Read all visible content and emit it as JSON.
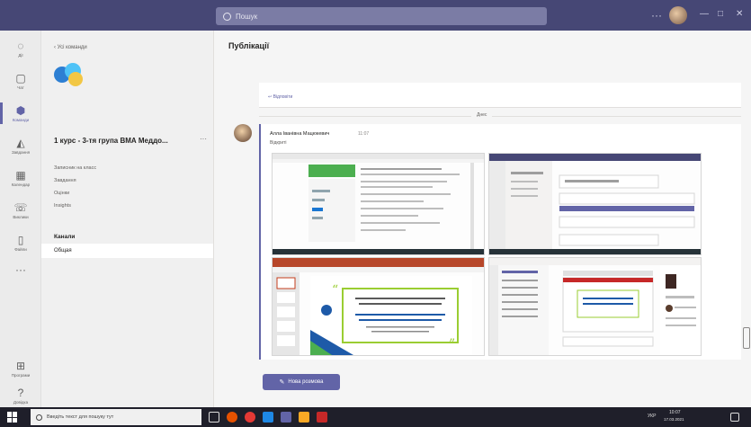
{
  "titlebar": {
    "search_placeholder": "Пошук",
    "more_label": "···",
    "minimize": "—",
    "maximize": "□",
    "close": "✕"
  },
  "rail": [
    {
      "label": "Дії",
      "icon": "bell-icon",
      "glyph": "◌"
    },
    {
      "label": "Чат",
      "icon": "chat-icon",
      "glyph": "▢"
    },
    {
      "label": "Команди",
      "icon": "teams-icon",
      "glyph": "⬢"
    },
    {
      "label": "Завдання",
      "icon": "assignments-icon",
      "glyph": "◭"
    },
    {
      "label": "Календар",
      "icon": "calendar-icon",
      "glyph": "▦"
    },
    {
      "label": "Виклики",
      "icon": "phone-icon",
      "glyph": "☏"
    },
    {
      "label": "Файли",
      "icon": "files-icon",
      "glyph": "▯"
    },
    {
      "label": "",
      "icon": "more-apps-icon",
      "glyph": "···"
    },
    {
      "label": "Програми",
      "icon": "apps-icon",
      "glyph": "⊞"
    },
    {
      "label": "Довідка",
      "icon": "help-icon",
      "glyph": "?"
    }
  ],
  "panel": {
    "back_label": "‹  Усі команди",
    "team_name": "1 курс - 3-тя група ВМА Меддо...",
    "more": "···",
    "links": [
      "Записник на класс",
      "Завдання",
      "Оцінки",
      "Insights"
    ],
    "channels_header": "Канали",
    "active_channel": "Общая"
  },
  "main": {
    "title": "Публікації",
    "reply_label": "↩ Відповіти",
    "date_divider": "Днес",
    "post": {
      "author": "Алла Іванівна Мацюкевич",
      "time": "11:07",
      "subtitle": "Відкриті"
    },
    "new_conversation_label": "Нова розмова"
  },
  "taskbar": {
    "search_placeholder": "Введіть текст для пошуку тут",
    "tray_lang": "УКР",
    "tray_time": "10:07",
    "tray_date": "17.03.2021"
  },
  "colors": {
    "accent": "#6264a7",
    "titlebar": "#464775",
    "taskbar": "#1f1f2a"
  }
}
